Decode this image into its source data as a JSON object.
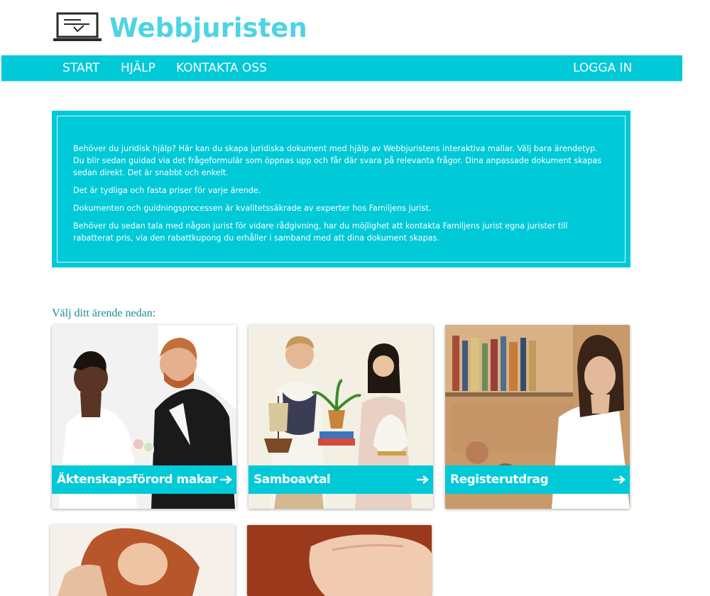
{
  "brand": {
    "name": "Webbjuristen",
    "logo_icon": "laptop-check-icon"
  },
  "nav": {
    "start": "START",
    "help": "HJÄLP",
    "contact": "KONTAKTA OSS",
    "login": "LOGGA IN"
  },
  "intro": {
    "p1": "Behöver du juridisk hjälp? Här kan du skapa juridiska dokument med hjälp av Webbjuristens interaktiva mallar. Välj bara ärendetyp. Du blir sedan guidad via det frågeformulär som öppnas upp och får där svara på relevanta frågor. Dina anpassade dokument skapas sedan direkt. Det är snabbt och enkelt.",
    "p2": "Det är tydliga och fasta priser för varje ärende.",
    "p3": "Dokumenten och guidningsprocessen är kvalitetssäkrade av experter hos Familjens jurist.",
    "p4": "Behöver du sedan tala med någon jurist för vidare rådgivning, har du möjlighet att kontakta Familjens jurist egna jurister till rabatterat pris, via den rabattkupong du erhåller i samband med att dina dokument skapas."
  },
  "choose_label": "Välj ditt ärende nedan:",
  "cards": [
    {
      "title": "Äktenskapsförord makar",
      "icon": "arrow-right-icon"
    },
    {
      "title": "Samboavtal",
      "icon": "arrow-right-icon"
    },
    {
      "title": "Registerutdrag",
      "icon": "arrow-right-icon"
    },
    {
      "title": "",
      "icon": ""
    },
    {
      "title": "",
      "icon": ""
    }
  ],
  "colors": {
    "accent": "#00c9d8",
    "logo": "#4ed4e4",
    "link_text": "#1b8b95"
  }
}
